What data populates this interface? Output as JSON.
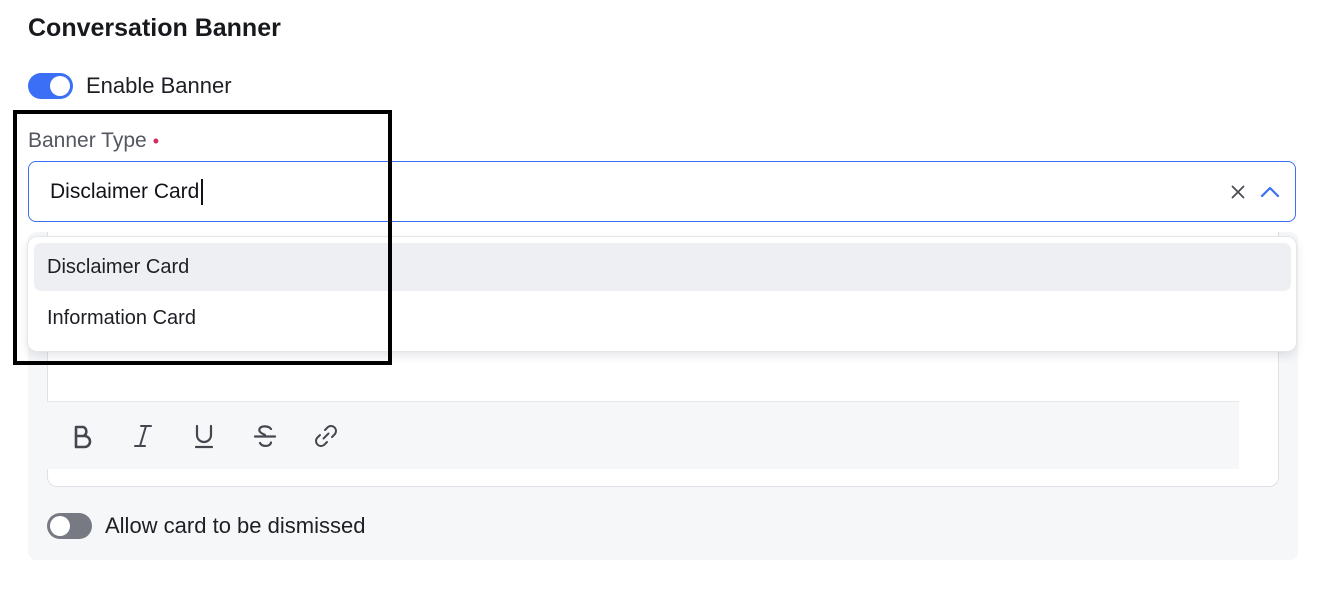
{
  "section": {
    "title": "Conversation Banner"
  },
  "enable_banner": {
    "label": "Enable Banner",
    "enabled": true
  },
  "banner_type": {
    "label": "Banner Type",
    "required_marker": "•",
    "value": "Disclaimer Card",
    "open": true
  },
  "dropdown": {
    "options": [
      {
        "label": "Disclaimer Card",
        "highlighted": true
      },
      {
        "label": "Information Card",
        "highlighted": false
      }
    ]
  },
  "format_toolbar": {
    "buttons": [
      "bold-icon",
      "italic-icon",
      "underline-icon",
      "strikethrough-icon",
      "link-icon"
    ]
  },
  "dismiss": {
    "label": "Allow card to be dismissed",
    "enabled": false
  },
  "colors": {
    "accent": "#3b6ff5",
    "required": "#d62a5f",
    "toggle_off": "#777a82",
    "panel_bg": "#f6f7f9"
  }
}
